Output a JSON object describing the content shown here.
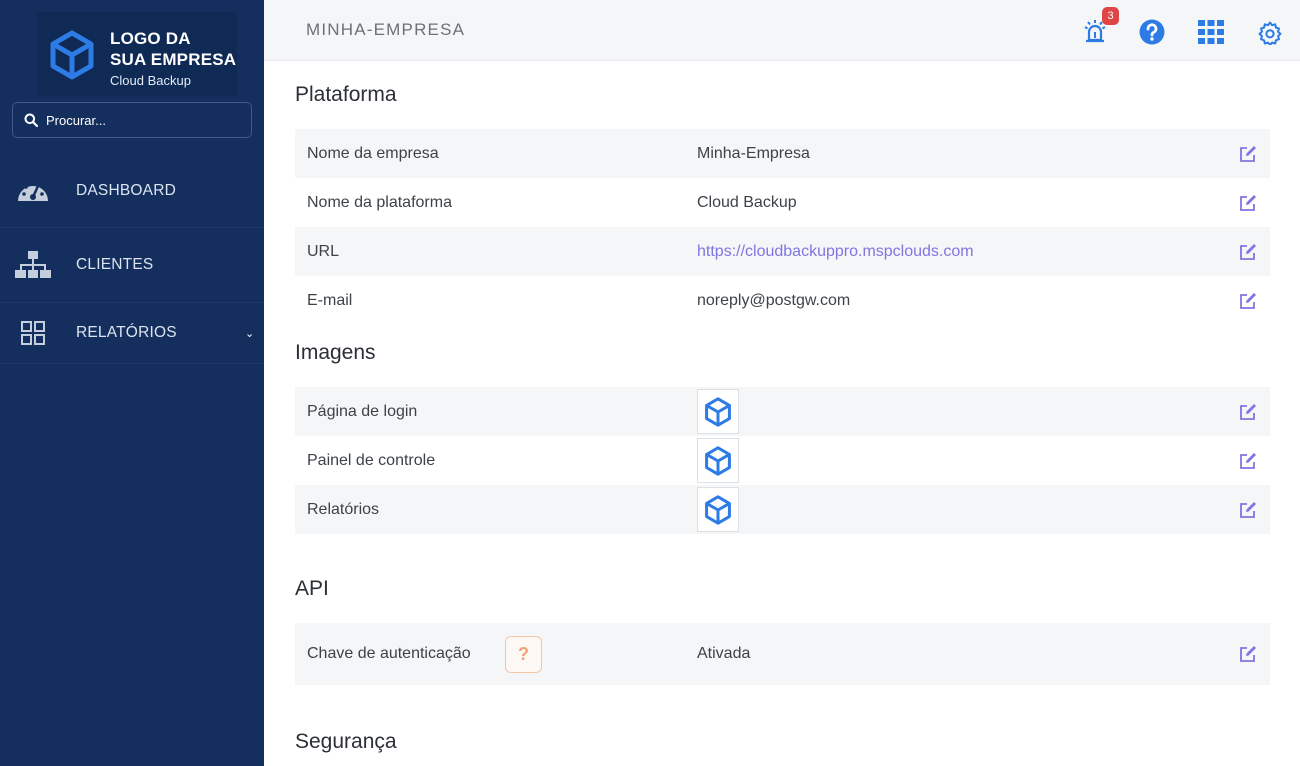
{
  "sidebar": {
    "logo": {
      "line1": "LOGO DA",
      "line2": "SUA EMPRESA",
      "subtitle": "Cloud Backup",
      "icon": "cube-icon"
    },
    "search": {
      "placeholder": "Procurar..."
    },
    "items": [
      {
        "label": "DASHBOARD",
        "icon": "speedometer-icon"
      },
      {
        "label": "CLIENTES",
        "icon": "sitemap-icon"
      },
      {
        "label": "RELATÓRIOS",
        "icon": "grid-icon",
        "chevron": "⌄"
      }
    ]
  },
  "topbar": {
    "company": "MINHA-EMPRESA",
    "alarm_badge": "3",
    "icons": [
      "alarm-icon",
      "help-icon",
      "apps-grid-icon",
      "settings-icon"
    ]
  },
  "sections": {
    "plataforma": {
      "title": "Plataforma",
      "rows": [
        {
          "label": "Nome da empresa",
          "value": "Minha-Empresa"
        },
        {
          "label": "Nome da plataforma",
          "value": "Cloud Backup"
        },
        {
          "label": "URL",
          "value": "https://cloudbackuppro.mspclouds.com"
        },
        {
          "label": "E-mail",
          "value": "noreply@postgw.com"
        }
      ]
    },
    "imagens": {
      "title": "Imagens",
      "rows": [
        {
          "label": "Página de login"
        },
        {
          "label": "Painel de controle"
        },
        {
          "label": "Relatórios"
        }
      ]
    },
    "api": {
      "title": "API",
      "rows": [
        {
          "label": "Chave de autenticação",
          "help": "?",
          "value": "Ativada"
        }
      ]
    },
    "seguranca": {
      "title": "Segurança"
    }
  },
  "colors": {
    "sidebar_bg": "#142f5e",
    "accent_blue": "#2d7be5",
    "link": "#7f76e0",
    "edit_icon": "#7f76e0",
    "badge": "#e04545"
  }
}
